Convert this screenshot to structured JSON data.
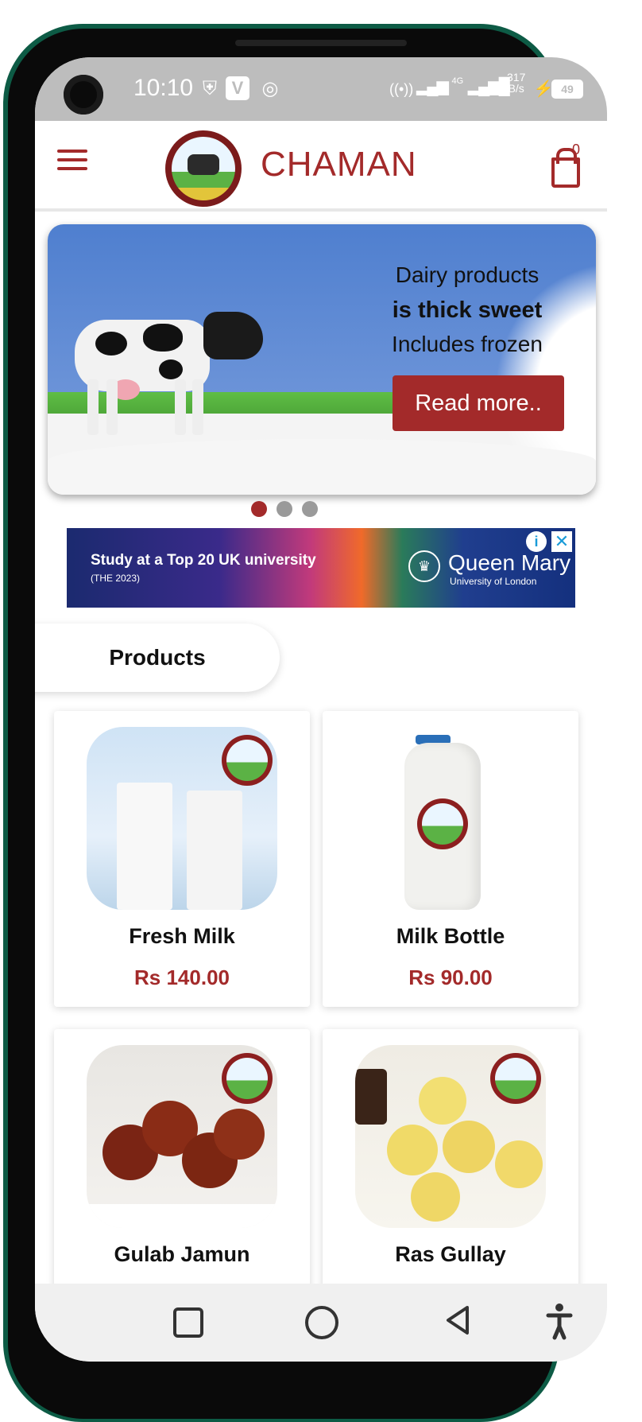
{
  "status_bar": {
    "time": "10:10",
    "network": "4G",
    "speed_value": "317",
    "speed_unit": "B/s",
    "battery": "49"
  },
  "header": {
    "brand": "CHAMAN",
    "cart_count": "0",
    "icons": [
      "menu-icon",
      "logo",
      "cart-icon"
    ]
  },
  "banner": {
    "line1": "Dairy products",
    "line2": "is thick sweet",
    "line3": "Includes frozen",
    "button_label": "Read more..",
    "slides": 3,
    "active_slide": 1
  },
  "ad": {
    "title": "Study at a Top 20 UK university",
    "subtitle": "(THE 2023)",
    "brand": "Queen Mary",
    "brand_sub": "University of London"
  },
  "section": {
    "label": "Products"
  },
  "products": [
    {
      "name": "Fresh Milk",
      "price": "Rs 140.00"
    },
    {
      "name": "Milk Bottle",
      "price": "Rs 90.00"
    },
    {
      "name": "Gulab Jamun",
      "price": ""
    },
    {
      "name": "Ras Gullay",
      "price": ""
    }
  ],
  "colors": {
    "accent": "#a32a2a",
    "statusbar": "#bdbdbd",
    "navbar": "#f0f0f0"
  }
}
